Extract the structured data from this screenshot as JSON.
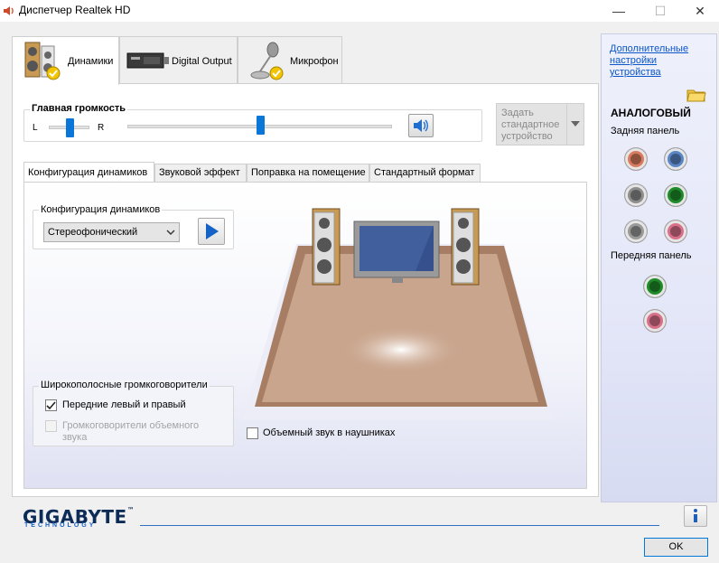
{
  "window": {
    "title": "Диспетчер Realtek HD",
    "min_glyph": "—",
    "max_glyph": "☐",
    "close_glyph": "✕"
  },
  "tabs": [
    {
      "label": "Динамики",
      "icon": "speakers-icon",
      "active": true
    },
    {
      "label": "Digital Output",
      "icon": "digital-output-icon",
      "active": false
    },
    {
      "label": "Микрофон",
      "icon": "microphone-icon",
      "active": false
    }
  ],
  "volume": {
    "title": "Главная громкость",
    "left_label": "L",
    "right_label": "R",
    "balance_level": 0.5,
    "volume_level": 0.5
  },
  "default_device_button": {
    "lines": [
      "Задать",
      "стандартное",
      "устройство"
    ]
  },
  "sub_tabs": [
    {
      "label": "Конфигурация динамиков",
      "active": true
    },
    {
      "label": "Звуковой эффект",
      "active": false
    },
    {
      "label": "Поправка на помещение",
      "active": false
    },
    {
      "label": "Стандартный формат",
      "active": false
    }
  ],
  "speaker_config": {
    "legend": "Конфигурация динамиков",
    "selected": "Стереофонический"
  },
  "fullrange": {
    "legend": "Широкополосные громкоговорители",
    "front": {
      "label": "Передние левый и правый",
      "checked": true,
      "enabled": true
    },
    "surround": {
      "label_line1": "Громкоговорители объемного",
      "label_line2": "звука",
      "checked": false,
      "enabled": false
    }
  },
  "headphone_virtualization": {
    "label": "Объемный звук в наушниках",
    "checked": false
  },
  "right_panel": {
    "link_lines": [
      "Дополнительные",
      "настройки",
      "устройства"
    ],
    "analog_title": "АНАЛОГОВЫЙ",
    "rear_label": "Задняя панель",
    "front_label": "Передняя панель",
    "rear_jacks": [
      "#d97b5f",
      "#5b86c6",
      "#8d8d8d",
      "#1e8a2a",
      "#9a9a9a",
      "#d9708a"
    ],
    "front_jacks": [
      "#1e8a2a",
      "#d9708a"
    ]
  },
  "footer": {
    "brand": "GIGABYTE",
    "brand_tm": "™",
    "brand_sub": "TECHNOLOGY",
    "ok_label": "OK"
  }
}
